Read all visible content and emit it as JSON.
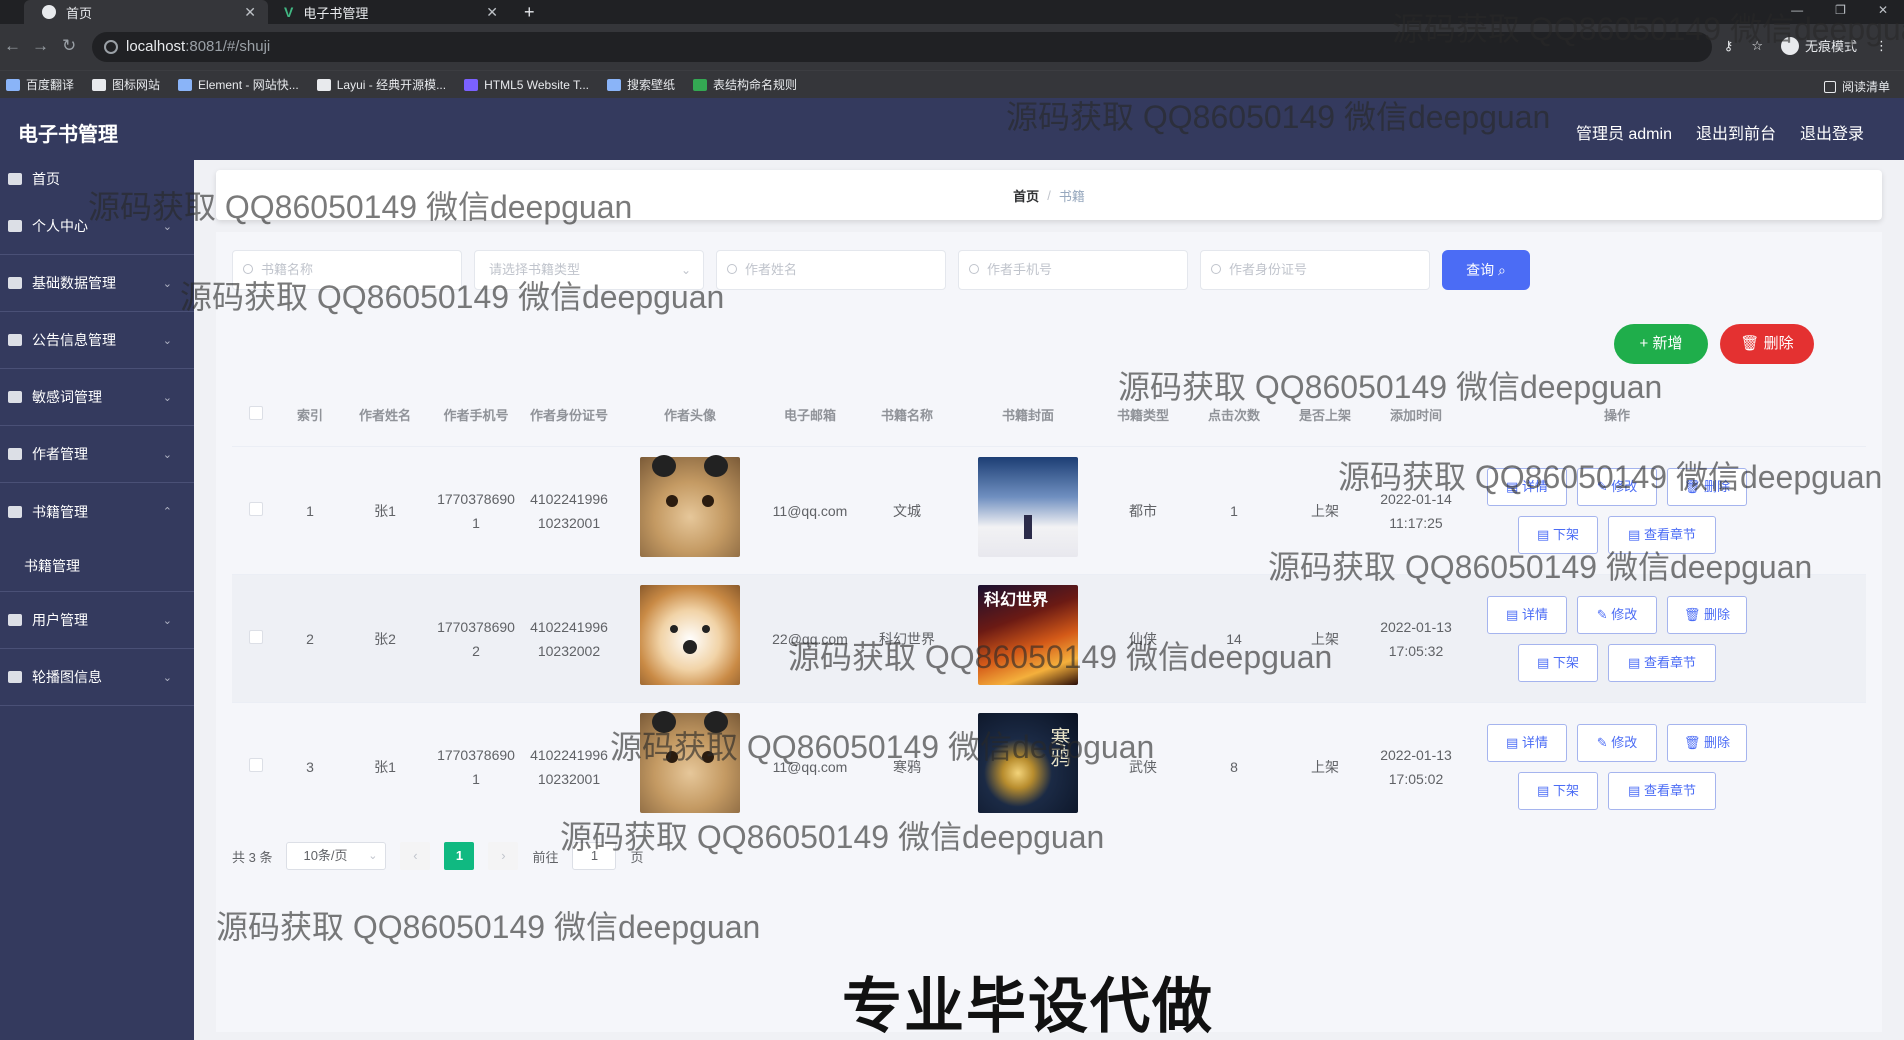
{
  "browser": {
    "tabs": [
      {
        "title": "首页"
      },
      {
        "title": "电子书管理"
      }
    ],
    "url_host": "localhost",
    "url_path": ":8081/#/shuji",
    "incognito_label": "无痕模式",
    "reading_list": "阅读清单",
    "bookmarks": [
      "百度翻译",
      "图标网站",
      "Element - 网站快...",
      "Layui - 经典开源模...",
      "HTML5 Website T...",
      "搜索壁纸",
      "表结构命名规则"
    ]
  },
  "app": {
    "title": "电子书管理",
    "user_label": "管理员 admin",
    "to_front": "退出到前台",
    "logout": "退出登录"
  },
  "sidebar": {
    "items": [
      {
        "label": "首页"
      },
      {
        "label": "个人中心"
      },
      {
        "label": "基础数据管理"
      },
      {
        "label": "公告信息管理"
      },
      {
        "label": "敏感词管理"
      },
      {
        "label": "作者管理"
      },
      {
        "label": "书籍管理"
      },
      {
        "label": "书籍管理"
      },
      {
        "label": "用户管理"
      },
      {
        "label": "轮播图信息"
      }
    ]
  },
  "breadcrumb": {
    "home": "首页",
    "separator": "/",
    "current": "书籍"
  },
  "search": {
    "book_name_placeholder": "书籍名称",
    "book_type_placeholder": "请选择书籍类型",
    "author_name_placeholder": "作者姓名",
    "author_phone_placeholder": "作者手机号",
    "author_id_placeholder": "作者身份证号",
    "query_label": "查询"
  },
  "actions": {
    "add_label": "+ 新增",
    "delete_label": "删除"
  },
  "table": {
    "headers": [
      "索引",
      "作者姓名",
      "作者手机号",
      "作者身份证号",
      "作者头像",
      "电子邮箱",
      "书籍名称",
      "书籍封面",
      "书籍类型",
      "点击次数",
      "是否上架",
      "添加时间",
      "操作"
    ],
    "rows": [
      {
        "index": "1",
        "author": "张1",
        "phone": "17703786901",
        "idno": "410224199610232001",
        "email": "11@qq.com",
        "book": "文城",
        "type": "都市",
        "clicks": "1",
        "shelf": "上架",
        "time": "2022-01-14 11:17:25"
      },
      {
        "index": "2",
        "author": "张2",
        "phone": "17703786902",
        "idno": "410224199610232002",
        "email": "22@qq.com",
        "book": "科幻世界",
        "type": "仙侠",
        "clicks": "14",
        "shelf": "上架",
        "time": "2022-01-13 17:05:32"
      },
      {
        "index": "3",
        "author": "张1",
        "phone": "17703786901",
        "idno": "410224199610232001",
        "email": "11@qq.com",
        "book": "寒鸦",
        "type": "武侠",
        "clicks": "8",
        "shelf": "上架",
        "time": "2022-01-13 17:05:02"
      }
    ],
    "op_labels": {
      "detail": "详情",
      "edit": "修改",
      "delete": "删除",
      "offshelf": "下架",
      "chapters": "查看章节"
    }
  },
  "pager": {
    "total": "共 3 条",
    "page_size": "10条/页",
    "current": "1",
    "goto": "前往",
    "goto_value": "1",
    "page_unit": "页"
  },
  "overlay": {
    "watermark": "源码获取 QQ86050149 微信deepguan",
    "caption": "专业毕设代做"
  },
  "colors": {
    "header_bg": "#343a5e",
    "primary": "#4b6cf5",
    "success": "#1fae4b",
    "danger": "#e43131",
    "pager_active": "#10b981"
  }
}
